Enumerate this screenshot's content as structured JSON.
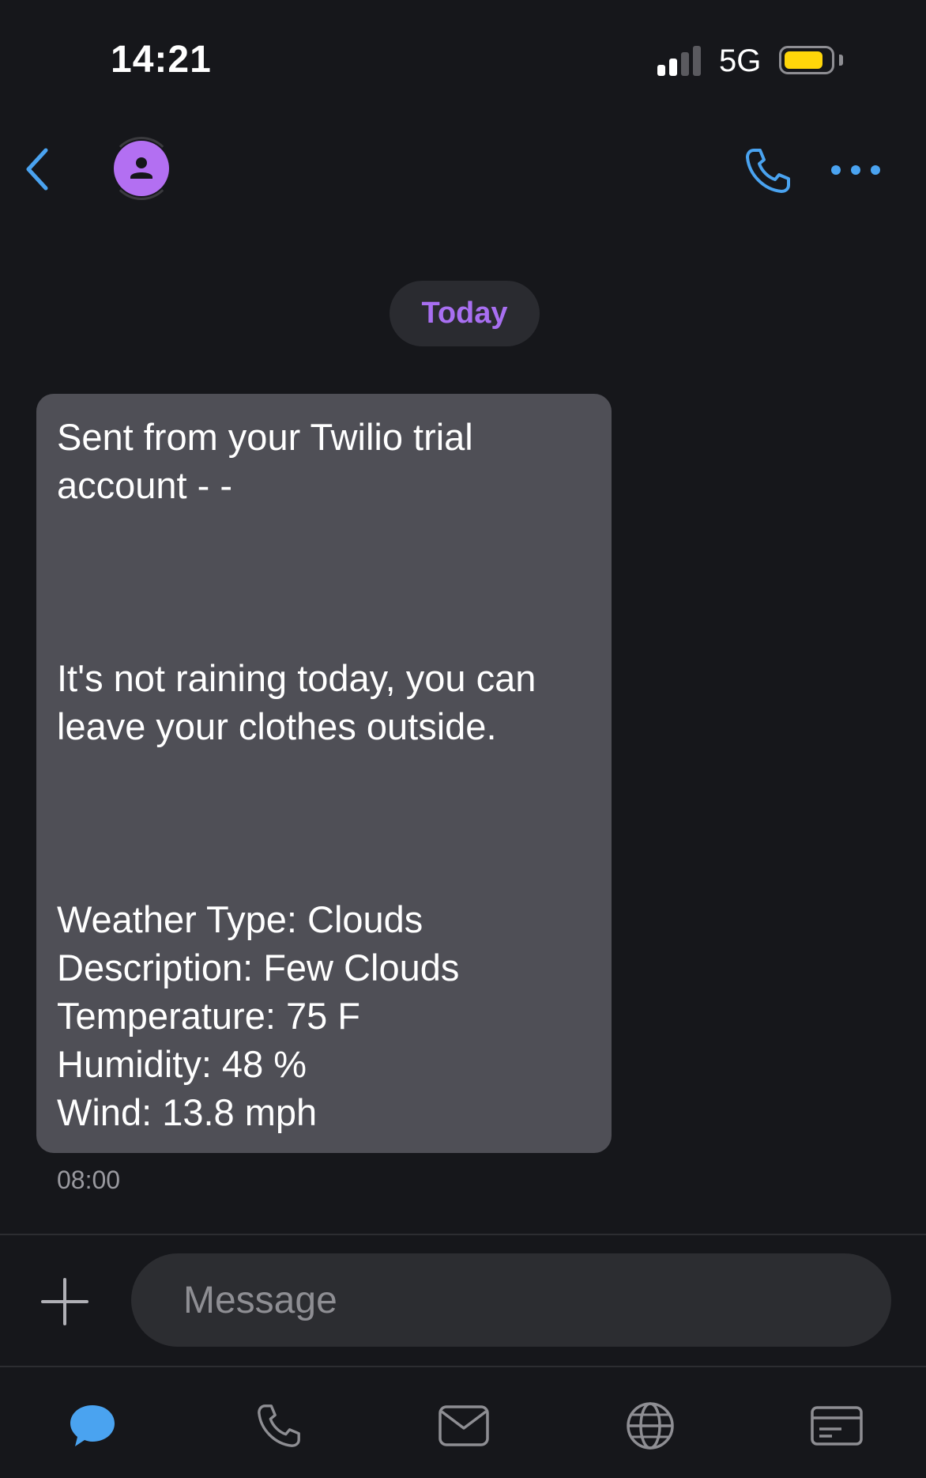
{
  "status_bar": {
    "time": "14:21",
    "network": "5G",
    "signal_bars_active": 2,
    "signal_bars_total": 4,
    "battery_level": 0.85,
    "battery_color": "#ffd60a"
  },
  "header": {
    "back_icon": "chevron-left-icon",
    "avatar_icon": "person-icon",
    "call_icon": "phone-icon",
    "more_icon": "ellipsis-icon",
    "accent_color": "#4aa3f0"
  },
  "conversation": {
    "date_label": "Today",
    "messages": [
      {
        "line1": "Sent from your Twilio trial account - -",
        "line2": "It's not raining today, you can leave your clothes outside.",
        "weather": [
          "Weather Type: Clouds",
          "Description: Few Clouds",
          "Temperature: 75 F",
          "Humidity: 48 %",
          "Wind: 13.8 mph"
        ],
        "timestamp": "08:00"
      }
    ]
  },
  "composer": {
    "placeholder": "Message",
    "add_icon": "plus-icon"
  },
  "bottom_nav": {
    "items": [
      "chat-bubble-icon",
      "phone-icon",
      "mail-icon",
      "globe-icon",
      "card-icon"
    ],
    "active_color": "#4aa3f0",
    "inactive_color": "#8e8e93"
  }
}
